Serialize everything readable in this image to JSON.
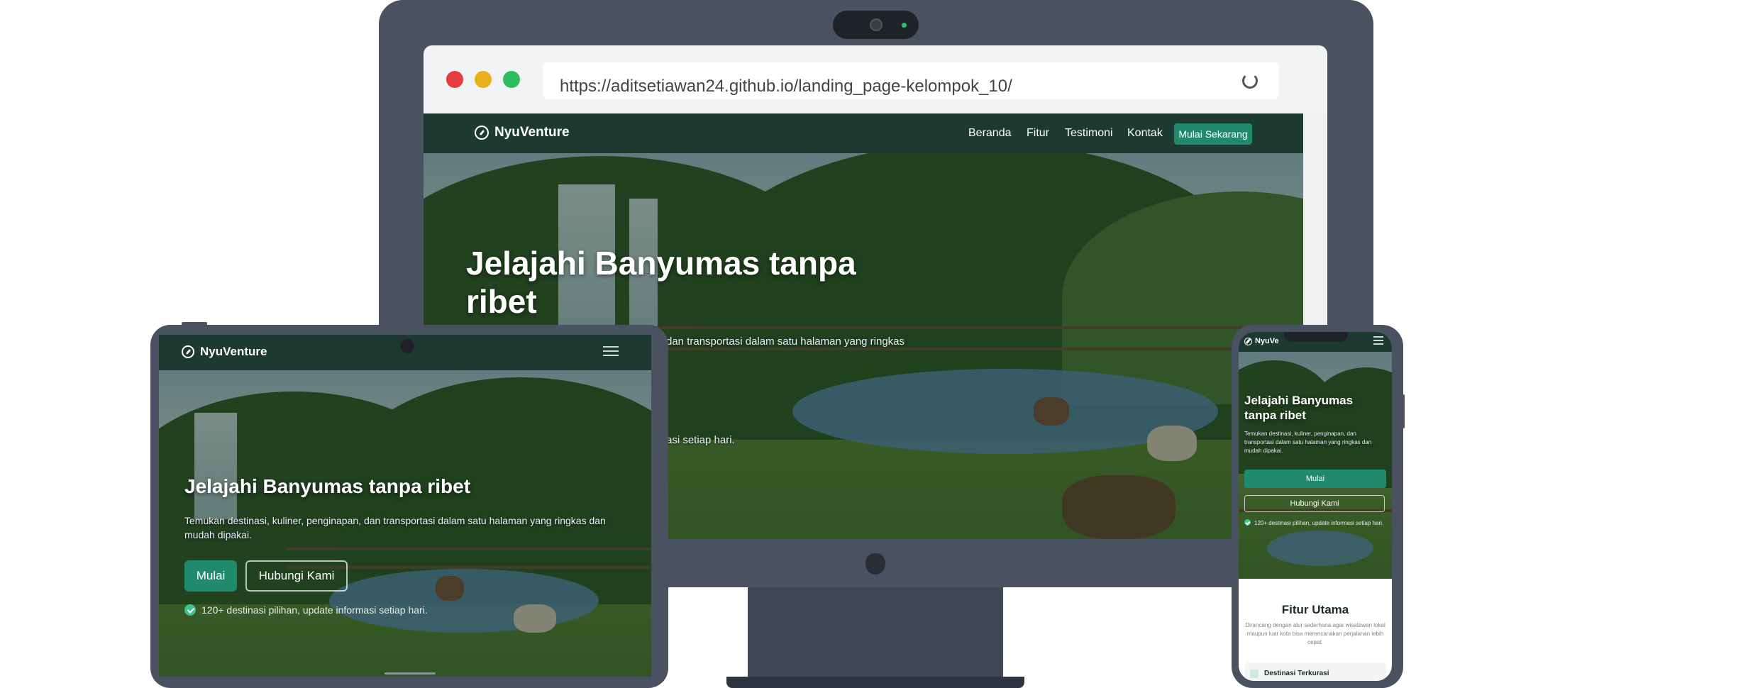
{
  "browser": {
    "url": "https://aditsetiawan24.github.io/landing_page-kelompok_10/"
  },
  "brand": "NyuVenture",
  "nav": {
    "items": [
      "Beranda",
      "Fitur",
      "Testimoni",
      "Kontak"
    ],
    "cta": "Mulai Sekarang"
  },
  "desktop": {
    "hero_title_line1": "Jelajahi Banyumas tanpa",
    "hero_title_line2": "ribet",
    "hero_desc_visible": "dan transportasi dalam satu halaman yang ringkas",
    "hero_tail_visible": "asi setiap hari."
  },
  "tablet": {
    "hero_title": "Jelajahi Banyumas tanpa ribet",
    "hero_desc": "Temukan destinasi, kuliner, penginapan, dan transportasi dalam satu halaman yang ringkas dan mudah dipakai.",
    "btn_primary": "Mulai",
    "btn_secondary": "Hubungi Kami",
    "stat": "120+ destinasi pilihan, update informasi setiap hari."
  },
  "phone": {
    "brand_visible": "NyuVe",
    "hero_title_line1": "Jelajahi Banyumas",
    "hero_title_line2": "tanpa ribet",
    "hero_desc": "Temukan destinasi, kuliner, penginapan, dan transportasi dalam satu halaman yang ringkas dan mudah dipakai.",
    "btn_primary": "Mulai",
    "btn_secondary": "Hubungi Kami",
    "stat": "120+ destinasi pilihan, update informasi setiap hari.",
    "section_title": "Fitur Utama",
    "section_desc": "Dirancang dengan alur sederhana agar wisatawan lokal maupun luar kota bisa merencanakan perjalanan lebih cepat.",
    "card_title": "Destinasi Terkurasi"
  }
}
